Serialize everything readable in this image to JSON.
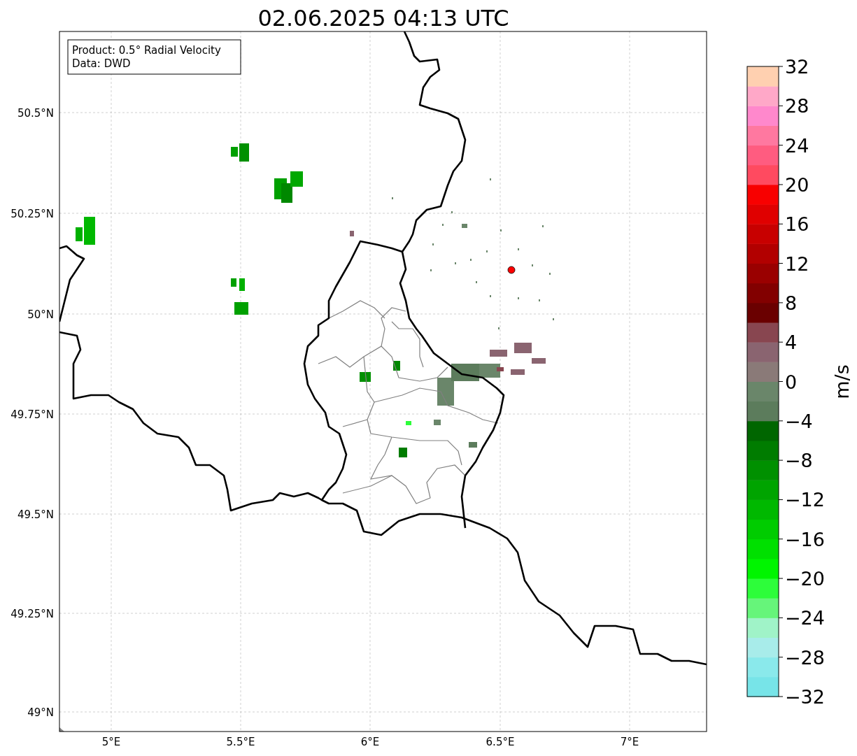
{
  "title": "02.06.2025 04:13 UTC",
  "legend": {
    "lines": [
      "Product: 0.5° Radial Velocity",
      "Data: DWD"
    ]
  },
  "map": {
    "y_ticks": [
      "50.5°N",
      "50.25°N",
      "50°N",
      "49.75°N",
      "49.5°N",
      "49.25°N",
      "49°N"
    ],
    "x_ticks": [
      "5°E",
      "5.5°E",
      "6°E",
      "6.5°E",
      "7°E"
    ]
  },
  "colorbar": {
    "label": "m/s",
    "ticks": [
      "32",
      "28",
      "24",
      "20",
      "16",
      "12",
      "8",
      "4",
      "0",
      "−4",
      "−8",
      "−12",
      "−16",
      "−20",
      "−24",
      "−28",
      "−32"
    ],
    "segments": [
      {
        "color": "#77e4e8"
      },
      {
        "color": "#8ae9eb"
      },
      {
        "color": "#a8ecea"
      },
      {
        "color": "#a0f3c8"
      },
      {
        "color": "#66f57a"
      },
      {
        "color": "#2dfd3a"
      },
      {
        "color": "#00f500"
      },
      {
        "color": "#00e000"
      },
      {
        "color": "#00cc00"
      },
      {
        "color": "#00b800"
      },
      {
        "color": "#00a400"
      },
      {
        "color": "#009000"
      },
      {
        "color": "#007c00"
      },
      {
        "color": "#006600"
      },
      {
        "color": "#5c7c5c"
      },
      {
        "color": "#6a866a"
      },
      {
        "color": "#8a7a78"
      },
      {
        "color": "#8a6470"
      },
      {
        "color": "#884650"
      },
      {
        "color": "#6a0000"
      },
      {
        "color": "#820000"
      },
      {
        "color": "#9a0000"
      },
      {
        "color": "#b20000"
      },
      {
        "color": "#c80000"
      },
      {
        "color": "#e00000"
      },
      {
        "color": "#f80000"
      },
      {
        "color": "#ff4a60"
      },
      {
        "color": "#ff5c80"
      },
      {
        "color": "#ff78a0"
      },
      {
        "color": "#ff88cc"
      },
      {
        "color": "#ffa8c8"
      },
      {
        "color": "#ffd0b0"
      }
    ]
  }
}
